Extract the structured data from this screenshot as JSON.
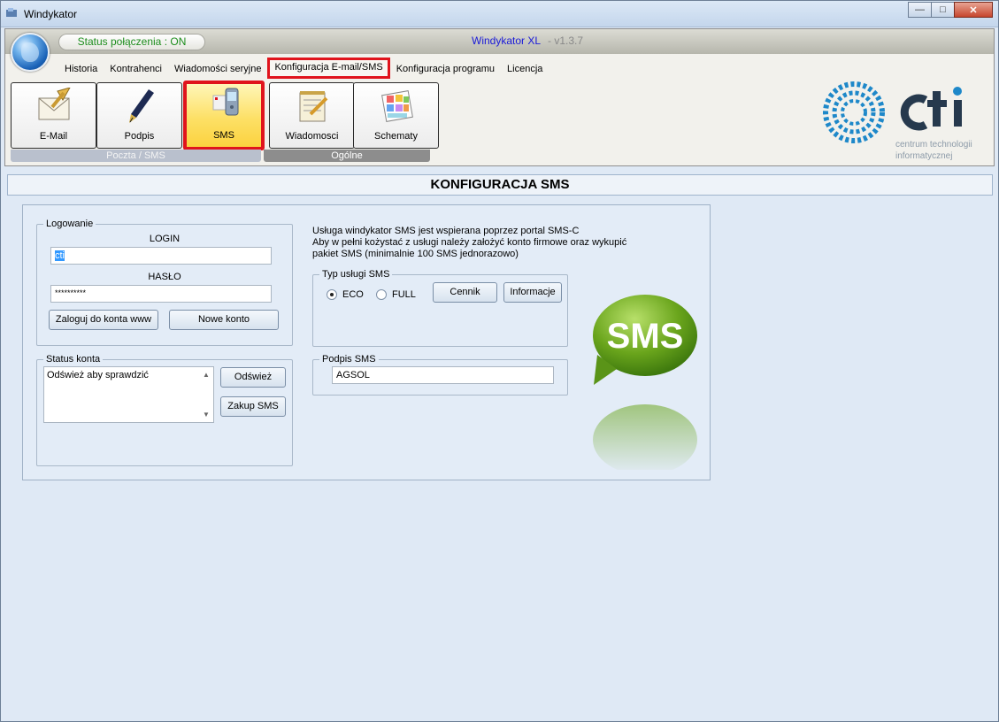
{
  "window": {
    "title": "Windykator",
    "controls": {
      "minimize": "—",
      "maximize": "□",
      "close": "✕"
    }
  },
  "header": {
    "status": "Status połączenia : ON",
    "app_name": "Windykator XL",
    "version": " - v1.3.7"
  },
  "menu": {
    "items": [
      {
        "label": "Historia"
      },
      {
        "label": "Kontrahenci"
      },
      {
        "label": "Wiadomości seryjne"
      },
      {
        "label": "Konfiguracja E-mail/SMS",
        "active": true
      },
      {
        "label": "Konfiguracja programu"
      },
      {
        "label": "Licencja"
      }
    ]
  },
  "toolbar": {
    "tiles": [
      {
        "label": "E-Mail",
        "icon": "email-icon"
      },
      {
        "label": "Podpis",
        "icon": "pen-icon"
      },
      {
        "label": "SMS",
        "icon": "phone-icon",
        "selected": true
      },
      {
        "label": "Wiadomosci",
        "icon": "notepad-icon"
      },
      {
        "label": "Schematy",
        "icon": "schemes-icon"
      }
    ],
    "groups": {
      "poczta": "Poczta / SMS",
      "ogolne": "Ogólne"
    }
  },
  "logo": {
    "name": "cti",
    "line1": "centrum technologii",
    "line2": "informatycznej"
  },
  "page": {
    "title": "KONFIGURACJA SMS"
  },
  "logowanie": {
    "legend": "Logowanie",
    "login_label": "LOGIN",
    "login_value": "cti",
    "password_label": "HASŁO",
    "password_value": "**********",
    "login_www_button": "Zaloguj do konta www",
    "new_account_button": "Nowe konto"
  },
  "status_konta": {
    "legend": "Status konta",
    "text": "Odśwież aby sprawdzić",
    "refresh_button": "Odśwież",
    "buy_button": "Zakup SMS"
  },
  "info": {
    "line1": "Usługa windykator SMS jest wspierana poprzez portal SMS-C",
    "line2": "Aby w pełni kożystać z usługi należy założyć konto firmowe oraz wykupić",
    "line3": "pakiet SMS (minimalnie 100 SMS jednorazowo)"
  },
  "typ_uslugi": {
    "legend": "Typ usługi SMS",
    "options": [
      {
        "label": "ECO",
        "checked": true
      },
      {
        "label": "FULL",
        "checked": false
      }
    ],
    "cennik_button": "Cennik",
    "informacje_button": "Informacje"
  },
  "podpis_sms": {
    "legend": "Podpis SMS",
    "value": "AGSOL"
  },
  "graphic": {
    "sms_text": "SMS"
  },
  "colors": {
    "highlight": "#e0141c",
    "status_green": "#1d8d1d",
    "app_name_blue": "#1a1ad8",
    "sms_green": "#6aa51c",
    "cti_blue": "#1e88c9"
  }
}
